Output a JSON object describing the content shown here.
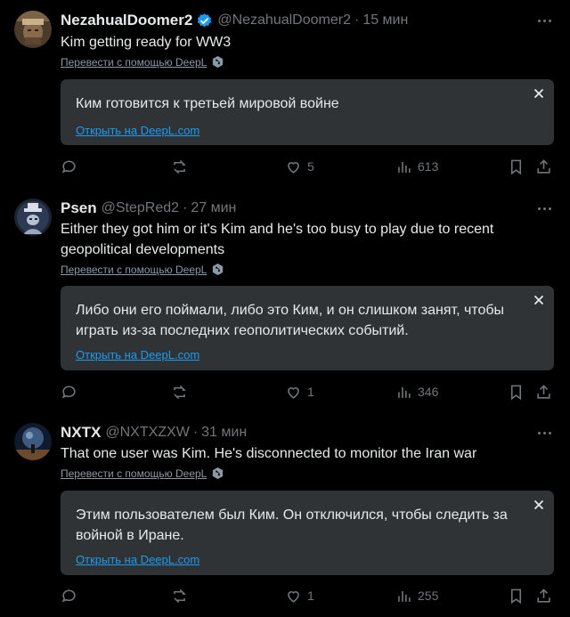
{
  "translate_label": "Перевести с помощью DeepL",
  "open_deepl_label": "Открыть на DeepL.com",
  "tweets": [
    {
      "name": "NezahualDoomer2",
      "verified": true,
      "handle": "@NezahualDoomer2",
      "dot": "·",
      "time": "15 мин",
      "text": "Kim getting ready for WW3",
      "translation": "Ким готовится к третьей мировой войне",
      "likes": "5",
      "views": "613"
    },
    {
      "name": "Psen",
      "verified": false,
      "handle": "@StepRed2",
      "dot": "·",
      "time": "27 мин",
      "text": "Either they got him or it's Kim and he's too busy to play due to recent geopolitical developments",
      "translation": "Либо они его поймали, либо это Ким, и он слишком занят, чтобы играть из-за последних геополитических событий.",
      "likes": "1",
      "views": "346"
    },
    {
      "name": "NXTX",
      "verified": false,
      "handle": "@NXTXZXW",
      "dot": "·",
      "time": "31 мин",
      "text": "That one user was Kim. He's disconnected to monitor the Iran war",
      "translation": "Этим пользователем был Ким. Он отключился, чтобы следить за войной в Иране.",
      "likes": "1",
      "views": "255"
    }
  ],
  "colors": {
    "background": "#000000",
    "text": "#e7e9ea",
    "muted": "#71767b",
    "link": "#1d9bf0",
    "translation_box": "#2f3336",
    "verified": "#1d9bf0"
  }
}
